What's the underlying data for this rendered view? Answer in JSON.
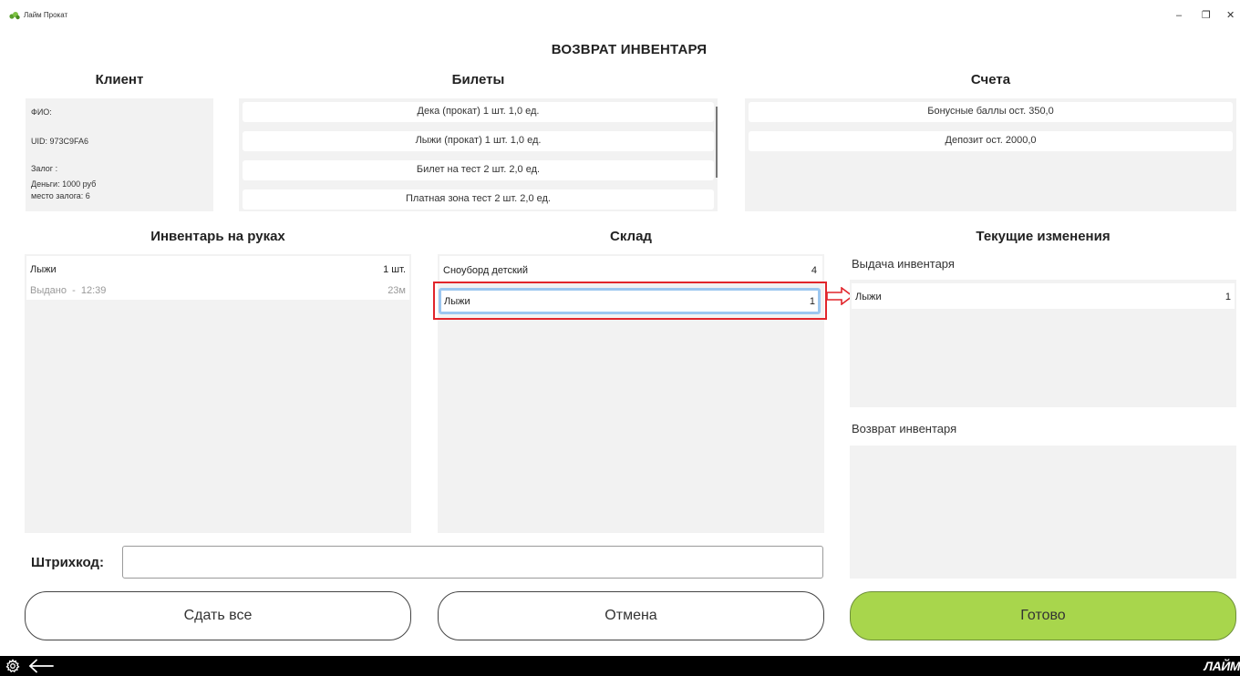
{
  "window": {
    "app_name": "Лайм Прокат",
    "minimize": "–",
    "restore": "❐",
    "close": "✕"
  },
  "page_title": "ВОЗВРАТ ИНВЕНТАРЯ",
  "client": {
    "header": "Клиент",
    "fio": "ФИО:",
    "uid": "UID: 973C9FA6",
    "deposit": "Залог :",
    "money": "Деньги: 1000 руб",
    "deposit_place": "место залога: 6"
  },
  "tickets": {
    "header": "Билеты",
    "items": [
      "Дека (прокат) 1 шт. 1,0 ед.",
      "Лыжи (прокат) 1 шт. 1,0 ед.",
      "Билет на тест 2 шт. 2,0 ед.",
      "Платная зона тест 2 шт. 2,0 ед."
    ]
  },
  "accounts": {
    "header": "Счета",
    "items": [
      "Бонусные баллы ост. 350,0",
      "Депозит ост. 2000,0"
    ]
  },
  "inventory_on_hand": {
    "header": "Инвентарь на руках",
    "items": [
      {
        "name": "Лыжи",
        "qty": "1 шт.",
        "status": "Выдано  -  12:39",
        "duration": "23м"
      }
    ]
  },
  "warehouse": {
    "header": "Склад",
    "items": [
      {
        "name": "Сноуборд детский",
        "qty": "4"
      },
      {
        "name": "Лыжи",
        "qty": "1"
      }
    ]
  },
  "current_changes": {
    "header": "Текущие изменения",
    "issue_header": "Выдача инвентаря",
    "issue_items": [
      {
        "name": "Лыжи",
        "qty": "1"
      }
    ],
    "return_header": "Возврат инвентаря"
  },
  "barcode": {
    "label": "Штрихкод:",
    "value": "",
    "placeholder": ""
  },
  "buttons": {
    "return_all": "Сдать все",
    "cancel": "Отмена",
    "done": "Готово"
  },
  "bottom": {
    "brand": "ЛАЙМ"
  },
  "colors": {
    "done_button": "#a8d64c",
    "highlight": "#e1252b",
    "selection": "#9cc7f0",
    "panel": "#f2f2f2"
  }
}
